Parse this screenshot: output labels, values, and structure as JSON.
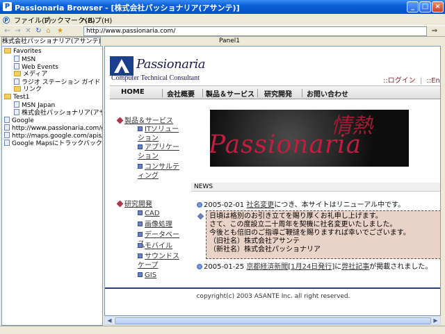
{
  "window": {
    "title": "Passionaria Browser - [株式会社パッショナリア(アサンテ)]",
    "minimize": "_",
    "maximize": "□",
    "close": "×"
  },
  "menu": [
    "ファイル(F)",
    "ブックマーク(B)",
    "ヘルプ(H)"
  ],
  "toolbar": {
    "back": "←",
    "forward": "→",
    "stop": "✕",
    "refresh": "↻",
    "home": "⌂",
    "favorites": "★",
    "address": "http://www.passionaria.com/",
    "go": "⇒"
  },
  "tabs": {
    "sidebar_tab": "株式会社パッショナリア(アサンテ)",
    "panel_tab": "Panel1"
  },
  "tree": [
    {
      "label": "Favorites",
      "type": "folder",
      "level": 0
    },
    {
      "label": "MSN",
      "type": "page",
      "level": 1
    },
    {
      "label": "Web Events",
      "type": "page",
      "level": 1
    },
    {
      "label": "メディア",
      "type": "folder",
      "level": 1
    },
    {
      "label": "ラジオ ステーション ガイド",
      "type": "page",
      "level": 1
    },
    {
      "label": "リンク",
      "type": "folder",
      "level": 1
    },
    {
      "label": "Test1",
      "type": "folder",
      "level": 0
    },
    {
      "label": "MSN Japan",
      "type": "page",
      "level": 1
    },
    {
      "label": "株式会社パッショナリア(アサンテ)",
      "type": "page",
      "level": 1
    },
    {
      "label": "Google",
      "type": "page",
      "level": 0
    },
    {
      "label": "http://www.passionaria.com/google_r",
      "type": "page",
      "level": 0
    },
    {
      "label": "http://maps.google.com/apis/の翻訳",
      "type": "page",
      "level": 0
    },
    {
      "label": "Google Mapsにトラックバック",
      "type": "page",
      "level": 0
    }
  ],
  "site": {
    "logo_name": "Passionaria",
    "logo_sub": "Computer Technical Consultant",
    "login": "::ログイン",
    "english": "::English",
    "nav": [
      "HOME",
      "会社概要",
      "製品＆サービス",
      "研究開発",
      "お問い合わせ"
    ],
    "products_heading": "製品＆サービス",
    "products": [
      "ITソリューション",
      "アプリケーション",
      "コンサルティング"
    ],
    "rnd_heading": "研究開発",
    "rnd": [
      "CAD",
      "画像処理",
      "データベース",
      "モバイル",
      "サウンドスケープ",
      "GIS"
    ],
    "banner_jp": "情熱",
    "banner_en": "Passionaria",
    "news_header": "NEWS",
    "news1_date": "2005-02-01",
    "news1_link": "社名変更",
    "news1_text": "につき、本サイトはリニューアル中です。",
    "notice_lines": [
      "日頃は格別のお引き立てを賜り厚くお礼申し上げます。",
      "さて、この度設立二十周年を契機に社名変更いたしました。",
      "今後とも倍旧のご指導ご鞭撻を賜りますれば幸いでございます。",
      "（旧社名）株式会社アサンテ",
      "（新社名）株式会社パッショナリア"
    ],
    "news2_date": "2005-01-25",
    "news2_link1": "京都経済新聞",
    "news2_link2": "1月24日発行",
    "news2_mid": "に",
    "news2_link3": "弊社記事",
    "news2_text": "が掲載されました。",
    "footer": "copyright(c) 2003 ASANTE Inc. all right reserved."
  },
  "colors": {
    "titlebar": "#0a5fd8",
    "accent_red": "#b4344a",
    "brand_blue": "#1a3f8c",
    "notice_bg": "#e9d2c8"
  }
}
